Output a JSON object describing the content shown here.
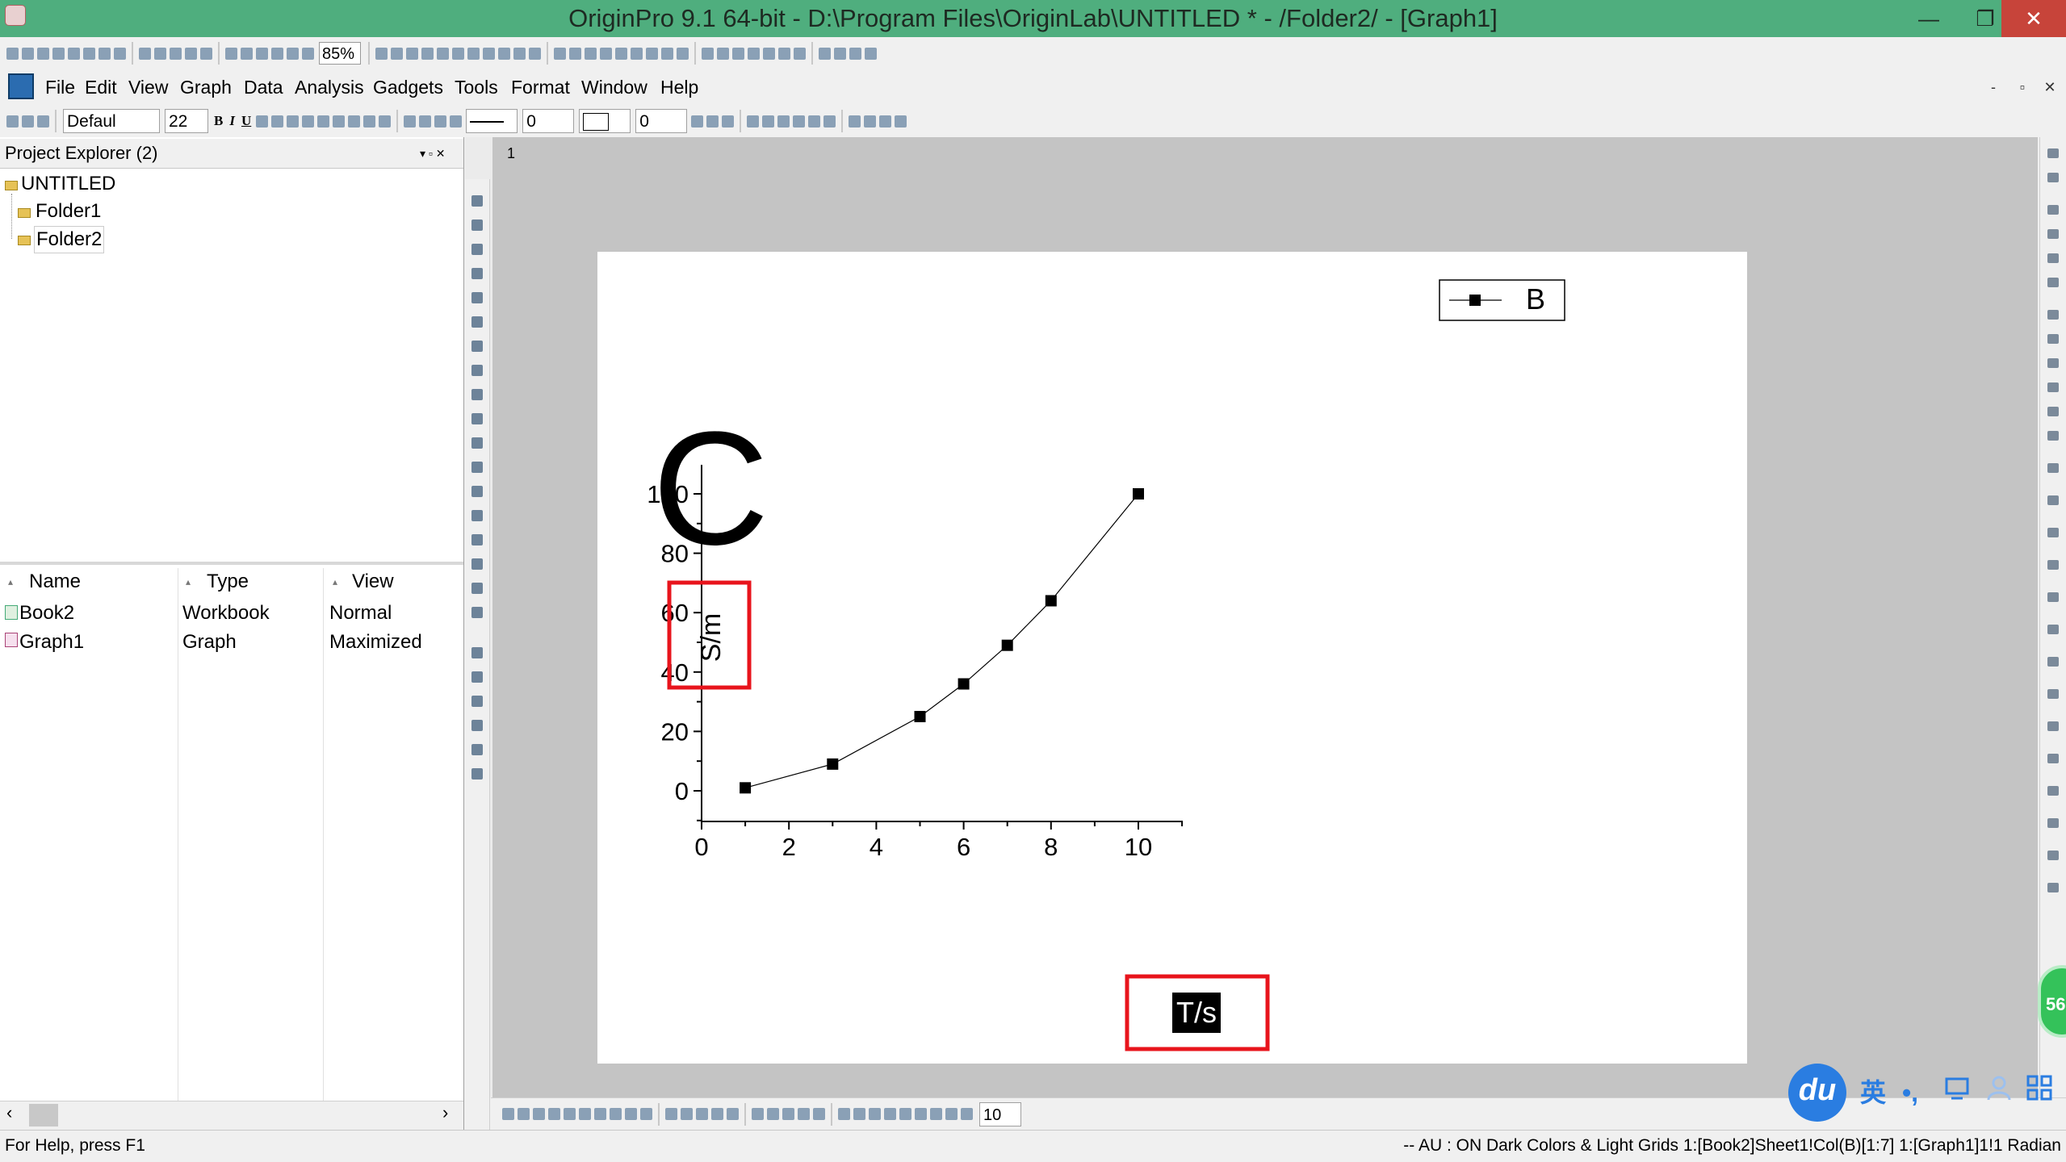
{
  "window": {
    "title": "OriginPro 9.1 64-bit - D:\\Program Files\\OriginLab\\UNTITLED * - /Folder2/ - [Graph1]",
    "controls": {
      "minimize": "—",
      "restore": "❐",
      "close": "✕"
    }
  },
  "toolbar": {
    "zoom": "85%"
  },
  "menu": {
    "items": [
      "File",
      "Edit",
      "View",
      "Graph",
      "Data",
      "Analysis",
      "Gadgets",
      "Tools",
      "Format",
      "Window",
      "Help"
    ],
    "mdi_controls": {
      "minimize": "-",
      "restore": "▫",
      "close": "✕"
    }
  },
  "format_toolbar": {
    "font_name": "Defaul",
    "font_size": "22",
    "line_width": "0",
    "border_width": "0"
  },
  "project_explorer": {
    "title": "Project Explorer (2)",
    "pin_controls": "▾ ▫ ✕",
    "root": "UNTITLED",
    "folders": [
      "Folder1",
      "Folder2"
    ],
    "columns": [
      "Name",
      "Type",
      "View"
    ],
    "rows": [
      {
        "name": "Book2",
        "type": "Workbook",
        "view": "Normal"
      },
      {
        "name": "Graph1",
        "type": "Graph",
        "view": "Maximized"
      }
    ]
  },
  "workspace": {
    "layer_number": "1",
    "big_letter": "C"
  },
  "chart_data": {
    "type": "line",
    "x": [
      1,
      3,
      5,
      6,
      7,
      8,
      10
    ],
    "series": [
      {
        "name": "B",
        "values": [
          1,
          9,
          25,
          36,
          49,
          64,
          100
        ],
        "marker": "square",
        "color": "#000000"
      }
    ],
    "xlabel": "T/s",
    "ylabel": "S/m",
    "xlim": [
      0,
      11
    ],
    "ylim": [
      -10,
      110
    ],
    "x_ticks": [
      "0",
      "2",
      "4",
      "6",
      "8",
      "10"
    ],
    "y_ticks": [
      "0",
      "20",
      "40",
      "60",
      "80",
      "100"
    ],
    "grid": false,
    "legend": "top-right",
    "highlight_color": "#e8141c"
  },
  "bottom_toolbar": {
    "value": "10"
  },
  "statusbar": {
    "left": "For Help, press F1",
    "right": "-- AU : ON Dark Colors & Light Grids 1:[Book2]Sheet1!Col(B)[1:7] 1:[Graph1]1!1 Radian"
  },
  "overlay": {
    "logo": "du",
    "ime_lang": "英",
    "ime_punct": "•,",
    "badge": "56"
  }
}
